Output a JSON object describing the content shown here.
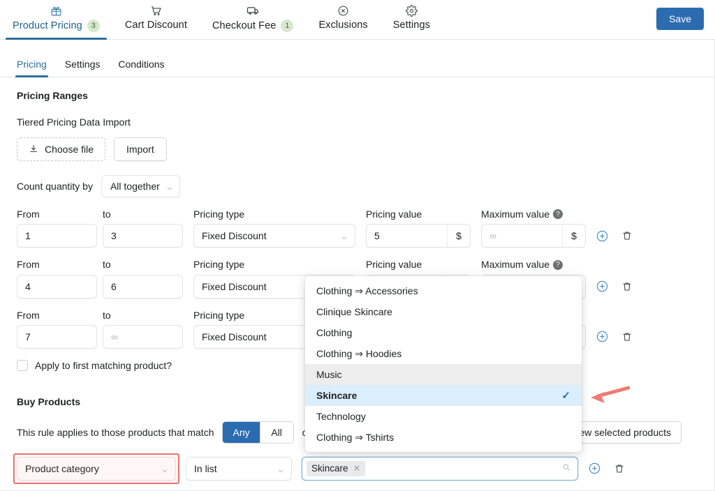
{
  "header": {
    "tabs": [
      {
        "label": "Product Pricing",
        "icon": "gift-icon",
        "badge": "3",
        "active": true
      },
      {
        "label": "Cart Discount",
        "icon": "cart-icon",
        "badge": "",
        "active": false
      },
      {
        "label": "Checkout Fee",
        "icon": "truck-icon",
        "badge": "1",
        "active": false
      },
      {
        "label": "Exclusions",
        "icon": "circle-x-icon",
        "badge": "",
        "active": false
      },
      {
        "label": "Settings",
        "icon": "gear-icon",
        "badge": "",
        "active": false
      }
    ],
    "save_label": "Save"
  },
  "subtabs": [
    {
      "label": "Pricing",
      "active": true
    },
    {
      "label": "Settings",
      "active": false
    },
    {
      "label": "Conditions",
      "active": false
    }
  ],
  "pricing": {
    "section_title": "Pricing Ranges",
    "import_label": "Tiered Pricing Data Import",
    "choose_file_label": "Choose file",
    "import_button_label": "Import",
    "count_label": "Count quantity by",
    "count_value": "All together",
    "columns": {
      "from": "From",
      "to": "to",
      "type": "Pricing type",
      "value": "Pricing value",
      "max": "Maximum value"
    },
    "rows": [
      {
        "from": "1",
        "to": "3",
        "to_placeholder": "",
        "type": "Fixed Discount",
        "value": "5",
        "value_suffix": "$",
        "max": "",
        "max_placeholder": "∞",
        "max_suffix": "$"
      },
      {
        "from": "4",
        "to": "6",
        "to_placeholder": "",
        "type": "Fixed Discount",
        "value": "",
        "value_suffix": "$",
        "max": "",
        "max_placeholder": "∞",
        "max_suffix": "$"
      },
      {
        "from": "7",
        "to": "",
        "to_placeholder": "∞",
        "type": "Fixed Discount",
        "value": "",
        "value_suffix": "$",
        "max": "",
        "max_placeholder": "∞",
        "max_suffix": "$"
      }
    ],
    "apply_first_label": "Apply to first matching product?"
  },
  "buy_products": {
    "title": "Buy Products",
    "match_text": "This rule applies to those products that match",
    "segments": [
      {
        "label": "Any",
        "on": true
      },
      {
        "label": "All",
        "on": false
      }
    ],
    "of_text": "of t",
    "view_selected_label": "View selected products",
    "condition": {
      "field": "Product category",
      "operator": "In list",
      "tags": [
        {
          "label": "Skincare"
        }
      ]
    }
  },
  "dropdown": {
    "items": [
      {
        "label": "Clothing ⇒ Accessories",
        "state": "normal"
      },
      {
        "label": "Clinique Skincare",
        "state": "normal"
      },
      {
        "label": "Clothing",
        "state": "normal"
      },
      {
        "label": "Clothing ⇒ Hoodies",
        "state": "normal"
      },
      {
        "label": "Music",
        "state": "hover"
      },
      {
        "label": "Skincare",
        "state": "selected"
      },
      {
        "label": "Technology",
        "state": "normal"
      },
      {
        "label": "Clothing ⇒ Tshirts",
        "state": "normal"
      }
    ],
    "check_glyph": "✓"
  },
  "colors": {
    "accent": "#2b6cb0",
    "tab_active": "#2c6e9b",
    "badge_bg": "#d7e8cf",
    "badge_text": "#3f6b33",
    "selected_row": "#dbeefb",
    "hover_row": "#ededed",
    "annotation": "#e8736b"
  }
}
